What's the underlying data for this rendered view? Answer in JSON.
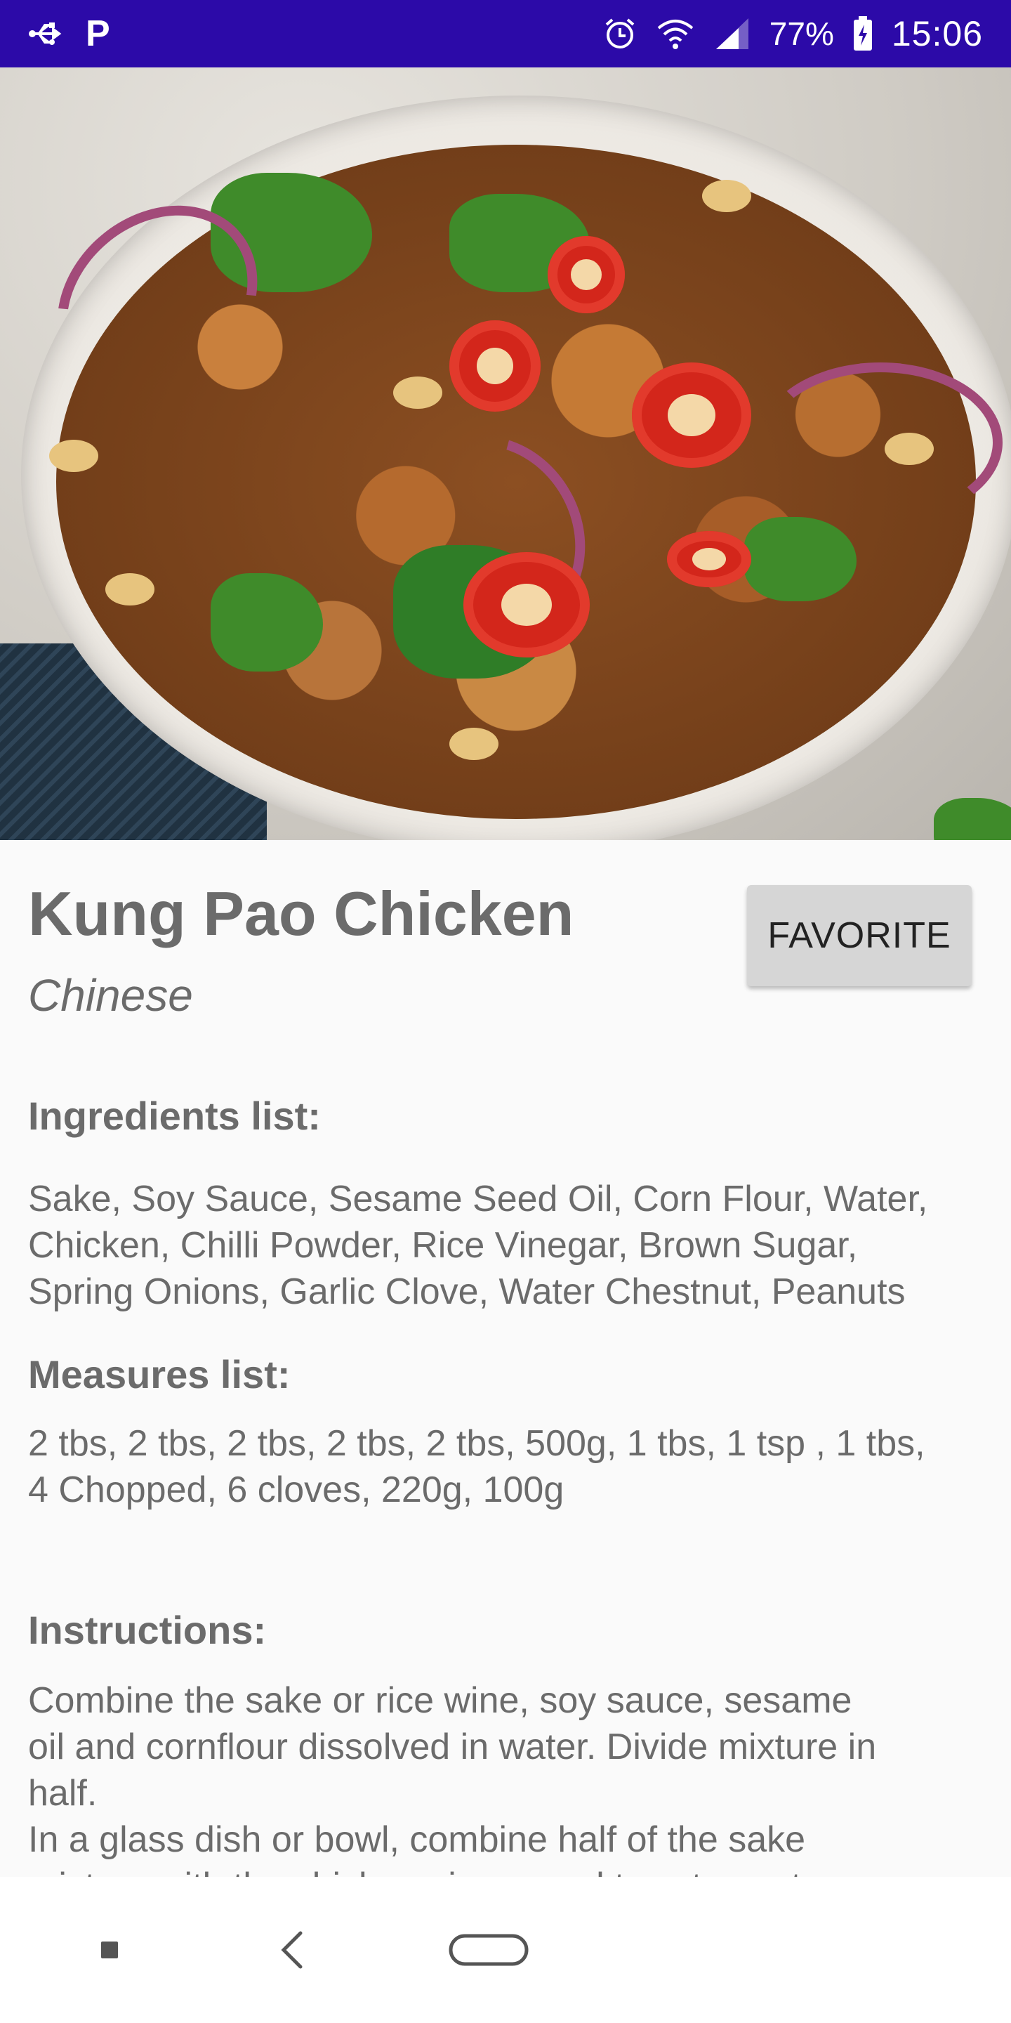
{
  "status_bar": {
    "battery": "77%",
    "time": "15:06",
    "p_icon": "P",
    "icons": [
      "usb-icon",
      "parking-icon",
      "alarm-icon",
      "wifi-icon",
      "signal-icon",
      "battery-icon"
    ]
  },
  "recipe": {
    "title": "Kung Pao Chicken",
    "cuisine": "Chinese",
    "favorite_label": "FAVORITE",
    "ingredients_heading": "Ingredients list:",
    "ingredients": "Sake, Soy Sauce, Sesame Seed Oil, Corn Flour, Water,\nChicken, Chilli Powder, Rice Vinegar, Brown Sugar,\nSpring Onions, Garlic Clove, Water Chestnut, Peanuts",
    "measures_heading": "Measures list:",
    "measures": "2 tbs, 2 tbs, 2 tbs, 2 tbs, 2 tbs, 500g, 1 tbs, 1 tsp , 1 tbs,\n4 Chopped, 6 cloves, 220g, 100g",
    "instructions_heading": "Instructions:",
    "instructions": "Combine the sake or rice wine, soy sauce, sesame\noil and cornflour dissolved in water. Divide mixture in\nhalf.\nIn a glass dish or bowl, combine half of the sake\nmixture with the chicken pieces and toss to coat."
  },
  "nav_bar": {
    "icons": [
      "recents-icon",
      "back-icon",
      "home-icon"
    ]
  }
}
